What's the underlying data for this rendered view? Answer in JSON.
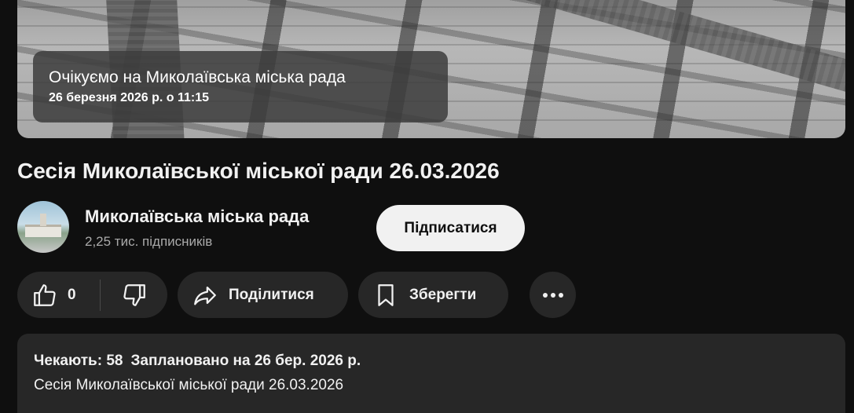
{
  "player": {
    "waiting_title": "Очікуємо на Миколаївська міська рада",
    "scheduled_datetime": "26 березня 2026 р. о 11:15"
  },
  "video": {
    "title": "Сесія Миколаївської міської ради 26.03.2026"
  },
  "channel": {
    "name": "Миколаївська міська рада",
    "subscribers": "2,25 тис. підписників",
    "subscribe_label": "Підписатися"
  },
  "actions": {
    "like_icon": "thumbs-up-icon",
    "like_count": "0",
    "dislike_icon": "thumbs-down-icon",
    "share_icon": "share-arrow-icon",
    "share_label": "Поділитися",
    "save_icon": "bookmark-icon",
    "save_label": "Зберегти",
    "more_icon": "more-horizontal-icon"
  },
  "description": {
    "waiting": "Чекають: 58",
    "scheduled": "Заплановано на 26 бер. 2026 р.",
    "text": "Сесія Миколаївської міської ради 26.03.2026"
  },
  "colors": {
    "background": "#0f0f0f",
    "surface": "#272727",
    "text_primary": "#f1f1f1",
    "text_secondary": "#aaaaaa",
    "subscribe_bg": "#f1f1f1"
  }
}
